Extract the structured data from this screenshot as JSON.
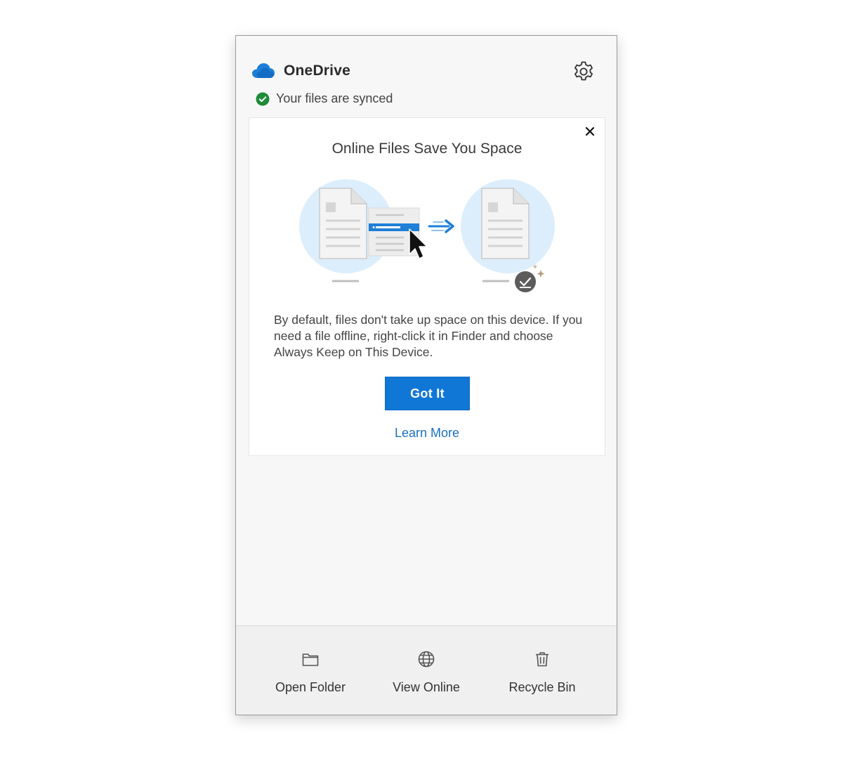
{
  "header": {
    "app_name": "OneDrive",
    "status": "Your files are synced",
    "settings_icon": "gear-icon",
    "cloud_icon": "onedrive-cloud-icon"
  },
  "promo_card": {
    "title": "Online Files Save You Space",
    "body": "By default, files don't take up space on this device. If you need a file offline, right-click it in Finder and choose Always Keep on This Device.",
    "primary_button": "Got It",
    "link": "Learn More",
    "close_icon": "close-icon"
  },
  "footer": {
    "items": [
      {
        "label": "Open Folder",
        "icon": "folder-icon"
      },
      {
        "label": "View Online",
        "icon": "globe-icon"
      },
      {
        "label": "Recycle Bin",
        "icon": "trash-icon"
      }
    ]
  },
  "colors": {
    "accent": "#1177d7",
    "link": "#1a6fc2",
    "synced_green": "#1f8a3a",
    "cloud_blue": "#1e7fd8"
  }
}
